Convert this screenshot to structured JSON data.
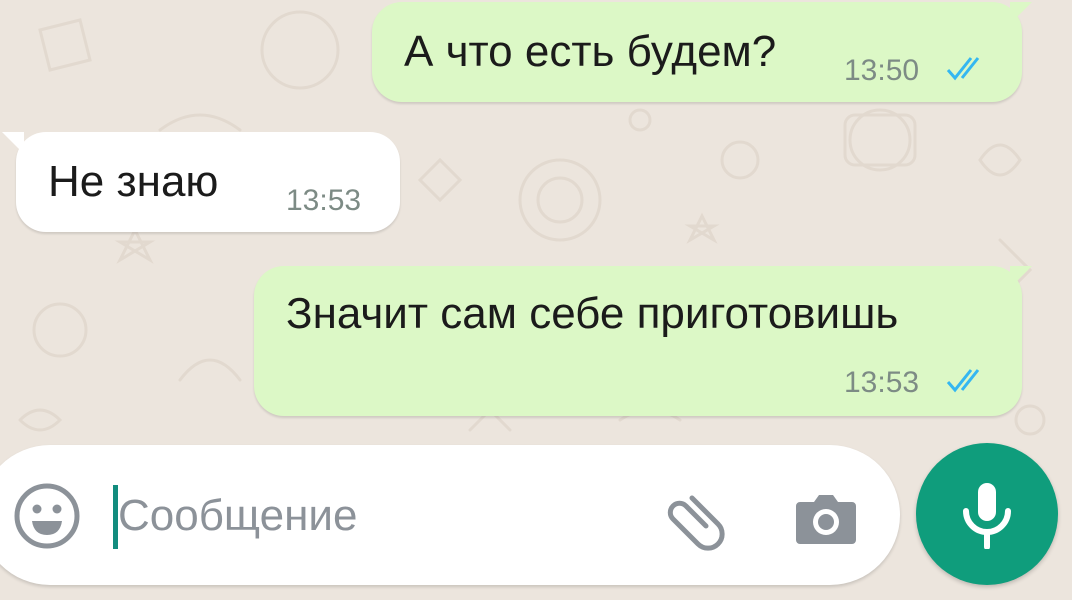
{
  "chat": {
    "messages": [
      {
        "direction": "outgoing",
        "text": "А что есть будем?",
        "time": "13:50",
        "status": "read"
      },
      {
        "direction": "incoming",
        "text": "Не знаю",
        "time": "13:53"
      },
      {
        "direction": "outgoing",
        "text": "Значит сам себе приготовишь",
        "time": "13:53",
        "status": "read"
      }
    ]
  },
  "composer": {
    "placeholder": "Сообщение",
    "value": "",
    "icons": {
      "emoji": "emoji-icon",
      "attach": "paperclip-icon",
      "camera": "camera-icon",
      "mic": "microphone-icon"
    }
  },
  "colors": {
    "background": "#ece5dd",
    "outgoing_bubble": "#dcf8c6",
    "incoming_bubble": "#ffffff",
    "read_ticks": "#34b7f1",
    "accent": "#128c7e",
    "mic_button": "#0f9d7c"
  }
}
